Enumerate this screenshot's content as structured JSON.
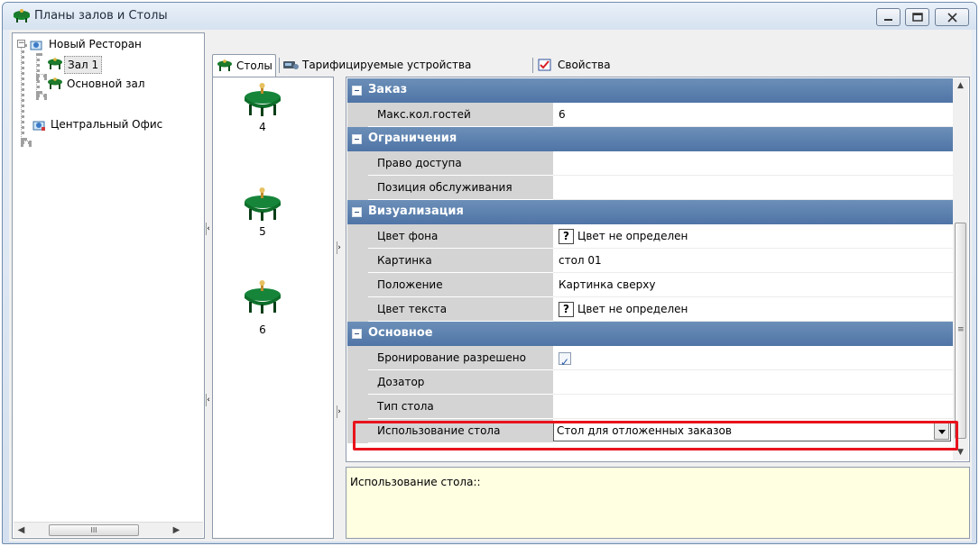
{
  "window": {
    "title": "Планы залов и Столы"
  },
  "tree": {
    "items": [
      {
        "label": "Новый Ресторан"
      },
      {
        "label": "Зал 1"
      },
      {
        "label": "Основной зал"
      },
      {
        "label": "Центральный Офис"
      }
    ],
    "scroll_thumb": "III"
  },
  "tabs": [
    {
      "label": "Столы"
    },
    {
      "label": "Тарифицируемые устройства"
    },
    {
      "label": "Свойства"
    }
  ],
  "tables": [
    {
      "number": "4"
    },
    {
      "number": "5"
    },
    {
      "number": "6"
    }
  ],
  "properties": {
    "cat_order": "Заказ",
    "max_guests_name": "Макс.кол.гостей",
    "max_guests_value": "6",
    "cat_limits": "Ограничения",
    "access_name": "Право доступа",
    "access_value": "",
    "position_name": "Позиция обслуживания",
    "position_value": "",
    "cat_visual": "Визуализация",
    "bgcolor_name": "Цвет фона",
    "bgcolor_value": "Цвет не определен",
    "picture_name": "Картинка",
    "picture_value": "стол 01",
    "placement_name": "Положение",
    "placement_value": "Картинка сверху",
    "textcolor_name": "Цвет текста",
    "textcolor_value": "Цвет не определен",
    "cat_main": "Основное",
    "booking_name": "Бронирование разрешено",
    "booking_checked": true,
    "dispenser_name": "Дозатор",
    "dispenser_value": "",
    "table_type_name": "Тип стола",
    "table_type_value": "",
    "usage_name": "Использование стола",
    "usage_value": "Стол для отложенных заказов"
  },
  "description": {
    "text": "Использование стола::"
  },
  "colors": {
    "category_bg": "#5a7eae",
    "highlight": "#e8131d",
    "description_bg": "#ffffe1"
  }
}
